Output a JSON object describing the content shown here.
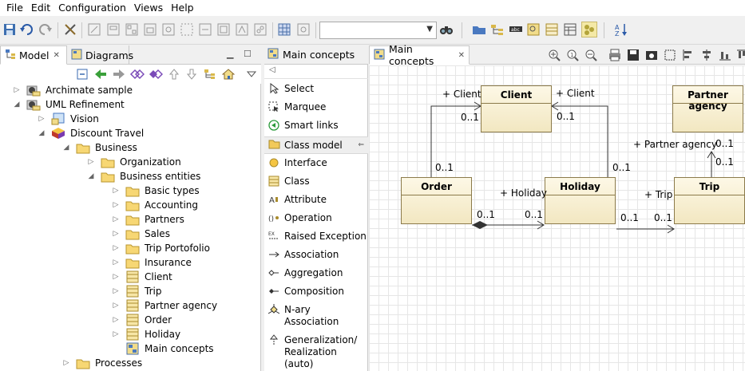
{
  "menu": [
    "File",
    "Edit",
    "Configuration",
    "Views",
    "Help"
  ],
  "left_tabs": {
    "model": "Model",
    "diagrams": "Diagrams"
  },
  "tree": [
    {
      "label": "Archimate sample"
    },
    {
      "label": "UML Refinement"
    },
    {
      "label": "Vision"
    },
    {
      "label": "Discount Travel"
    },
    {
      "label": "Business"
    },
    {
      "label": "Organization"
    },
    {
      "label": "Business entities"
    },
    {
      "label": "Basic types"
    },
    {
      "label": "Accounting"
    },
    {
      "label": "Partners"
    },
    {
      "label": "Sales"
    },
    {
      "label": "Trip Portofolio"
    },
    {
      "label": "Insurance"
    },
    {
      "label": "Client"
    },
    {
      "label": "Trip"
    },
    {
      "label": "Partner agency"
    },
    {
      "label": "Order"
    },
    {
      "label": "Holiday"
    },
    {
      "label": "Main concepts"
    },
    {
      "label": "Processes"
    }
  ],
  "palette_tab": "Main concepts",
  "palette": {
    "tools": [
      "Select",
      "Marquee",
      "Smart links"
    ],
    "group": "Class model",
    "items": [
      "Interface",
      "Class",
      "Attribute",
      "Operation",
      "Raised Exception",
      "Association",
      "Aggregation",
      "Composition",
      "N-ary\nAssociation",
      "Generalization/\nRealization\n(auto)"
    ]
  },
  "editor_tab": "Main concepts",
  "diagram": {
    "classes": {
      "client": "Client",
      "partner": "Partner agency",
      "order": "Order",
      "holiday": "Holiday",
      "trip": "Trip"
    },
    "labels": {
      "client_left_role": "+ Client",
      "client_left_mult": "0..1",
      "client_right_role": "+ Client",
      "client_right_mult": "0..1",
      "order_top_mult": "0..1",
      "holiday_top_mult": "0..1",
      "holiday_role": "+ Holiday",
      "order_agg_mult": "0..1",
      "holiday_left_mult": "0..1",
      "trip_role": "+ Trip",
      "holiday_right_mult": "0..1",
      "trip_left_mult": "0..1",
      "partner_role": "+ Partner agency",
      "partner_mult": "0..1",
      "trip_top_mult": "0..1"
    }
  }
}
